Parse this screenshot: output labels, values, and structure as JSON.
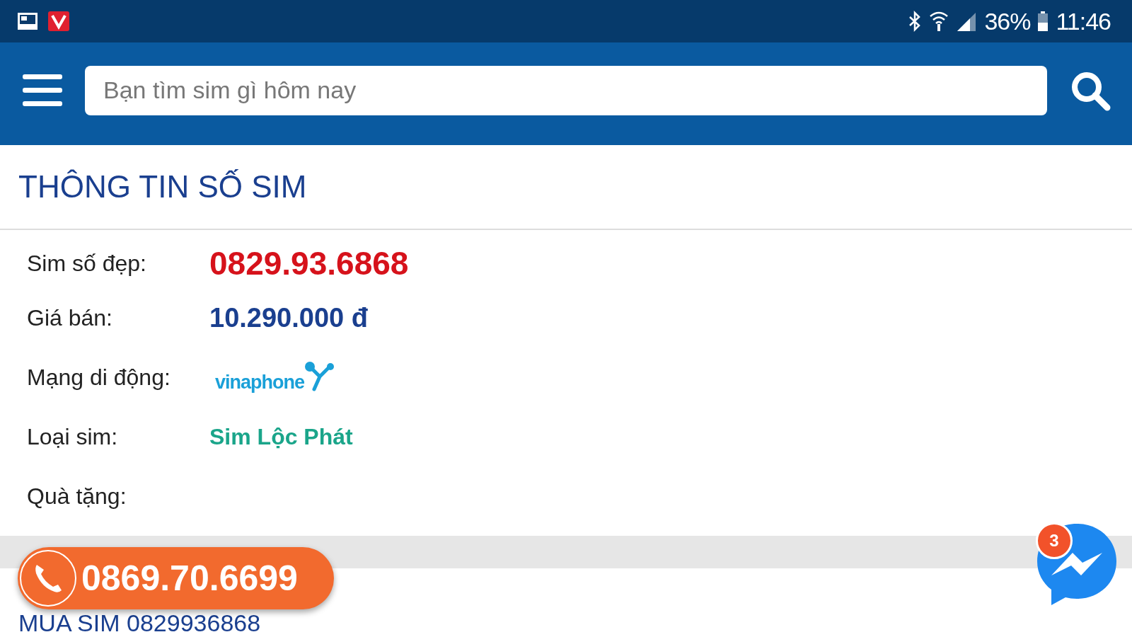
{
  "status_bar": {
    "battery": "36%",
    "time": "11:46"
  },
  "search": {
    "placeholder": "Bạn tìm sim gì hôm nay"
  },
  "section_title": "THÔNG TIN SỐ SIM",
  "details": [
    {
      "kind": "number",
      "label": "Sim số đẹp:",
      "value": "0829.93.6868"
    },
    {
      "kind": "price",
      "label": "Giá bán:",
      "value": "10.290.000 đ"
    },
    {
      "kind": "network",
      "label": "Mạng di động:",
      "value": "vinaphone"
    },
    {
      "kind": "type",
      "label": "Loại sim:",
      "value": "Sim Lộc Phát"
    },
    {
      "kind": "gift",
      "label": "Quà tặng:"
    }
  ],
  "buy_title": "MUA SIM 0829936868",
  "call_button": {
    "phone": "0869.70.6699"
  },
  "messenger": {
    "badge": "3"
  }
}
